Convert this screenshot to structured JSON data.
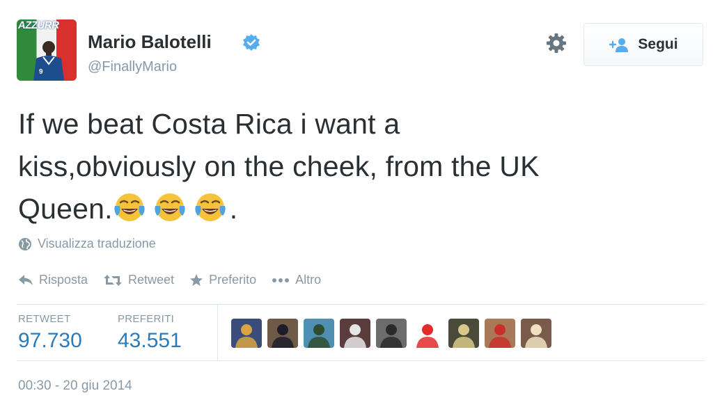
{
  "author": {
    "name": "Mario Balotelli",
    "handle": "@FinallyMario",
    "avatar_text": "AZZURR",
    "verified": true
  },
  "header": {
    "settings_icon": "gear-icon",
    "follow_label": "Segui"
  },
  "tweet": {
    "lines": [
      "If we beat Costa Rica i want a",
      "kiss,obviously on the cheek, from the UK",
      "Queen."
    ],
    "trailing": ".",
    "emoji": [
      "face-with-tears-of-joy",
      "face-with-tears-of-joy",
      "face-with-tears-of-joy"
    ]
  },
  "translate_label": "Visualizza traduzione",
  "actions": {
    "reply": "Risposta",
    "retweet": "Retweet",
    "favorite": "Preferito",
    "more": "Altro"
  },
  "stats": {
    "retweet_label": "RETWEET",
    "retweet_value": "97.730",
    "favorites_label": "PREFERITI",
    "favorites_value": "43.551",
    "faces": [
      {
        "bg": "#3a4c7a",
        "fg": "#d9a441"
      },
      {
        "bg": "#6f5a48",
        "fg": "#1d1d2a"
      },
      {
        "bg": "#4f8fb2",
        "fg": "#2e4d2e"
      },
      {
        "bg": "#5a3c3c",
        "fg": "#e6e6e6"
      },
      {
        "bg": "#6c6c6c",
        "fg": "#2a2a2a"
      },
      {
        "bg": "#ffffff",
        "fg": "#e32b2b"
      },
      {
        "bg": "#4a4a3a",
        "fg": "#d8c98a"
      },
      {
        "bg": "#a87a5a",
        "fg": "#c9302c"
      },
      {
        "bg": "#7a5a4a",
        "fg": "#f0e0c0"
      }
    ]
  },
  "timestamp": "00:30 - 20 giu 2014",
  "colors": {
    "link_blue": "#2b7bb9",
    "muted_gray": "#8899a6",
    "text_dark": "#292f33",
    "verified_blue": "#55acee"
  }
}
